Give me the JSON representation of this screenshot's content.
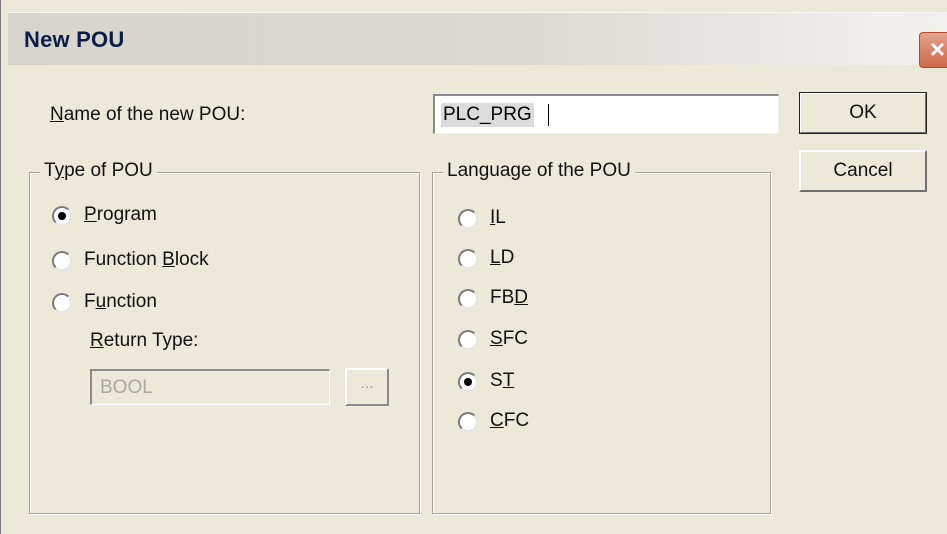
{
  "dialog": {
    "title": "New POU",
    "close_glyph": "×"
  },
  "name_field": {
    "label_hotkey": "N",
    "label_rest": "ame of the new POU:",
    "value": "PLC_PRG"
  },
  "buttons": {
    "ok": "OK",
    "cancel": "Cancel"
  },
  "type_group": {
    "legend_pre": "T",
    "legend_hotkey": "y",
    "legend_post": "pe of POU",
    "options": [
      {
        "pre": "",
        "hotkey": "P",
        "post": "rogram",
        "selected": true
      },
      {
        "pre": "Function ",
        "hotkey": "B",
        "post": "lock",
        "selected": false
      },
      {
        "pre": "F",
        "hotkey": "u",
        "post": "nction",
        "selected": false
      }
    ],
    "return_type_label_hotkey": "R",
    "return_type_label_rest": "eturn Type:",
    "return_type_value": "BOOL",
    "ellipsis": "..."
  },
  "language_group": {
    "legend_pre": "Lan",
    "legend_hotkey": "g",
    "legend_post": "uage of the POU",
    "options": [
      {
        "pre": "",
        "hotkey": "I",
        "post": "L",
        "selected": false
      },
      {
        "pre": "",
        "hotkey": "L",
        "post": "D",
        "selected": false
      },
      {
        "pre": "FB",
        "hotkey": "D",
        "post": "",
        "selected": false
      },
      {
        "pre": "",
        "hotkey": "S",
        "post": "FC",
        "selected": false
      },
      {
        "pre": "S",
        "hotkey": "T",
        "post": "",
        "selected": true
      },
      {
        "pre": "",
        "hotkey": "C",
        "post": "FC",
        "selected": false
      }
    ]
  },
  "icons": {
    "close": "close-icon",
    "radio_selected": "radio-selected-icon",
    "radio_unselected": "radio-unselected-icon"
  },
  "colors": {
    "dialog_bg": "#ece9d8",
    "close_button": "#cf6a4a",
    "title_text": "#0b1d48"
  }
}
